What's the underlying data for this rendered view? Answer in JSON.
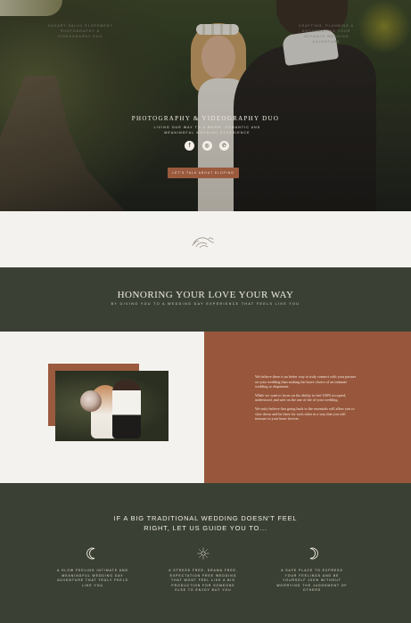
{
  "hero": {
    "title": "PHOTOGRAPHY & VIDEOGRAPHY DUO",
    "subtitle": "LIVING OUR WAY TO A WARM, ROMANTIC AND MEANINGFUL WEDDING EXPERIENCE",
    "socials": [
      {
        "icon": "facebook-icon",
        "glyph": "f"
      },
      {
        "icon": "instagram-icon",
        "glyph": "◎"
      },
      {
        "icon": "pinterest-icon",
        "glyph": "℗"
      }
    ],
    "cta_label": "LET'S TALK ABOUT ELOPING"
  },
  "strip": {
    "left_text": "SUGARY SALVO ELOPEMENT PHOTOGRAPHY & VIDEOGRAPHY DUO",
    "right_text": "CRAFTING, PLANNING & DOCUMENTING YOUR INTIMATE WEDDING ADVENTURE"
  },
  "band1": {
    "title": "HONORING YOUR LOVE YOUR WAY",
    "subtitle": "BY GIVING YOU TO A WEDDING DAY EXPERIENCE THAT FEELS LIKE YOU"
  },
  "split": {
    "paragraphs": [
      "We believe there is no better way to truly connect with your partner on your wedding than making the brave choice of an intimate wedding or elopement.",
      "While we want to focus on the ability to feel 100% accepted, understood, and safe on the one of the of your wedding.",
      "We truly believe that going back to the essentials will allow you to slow down and be there for each other in a way that you will treasure in your heart forever."
    ]
  },
  "band2": {
    "title": "IF A BIG TRADITIONAL WEDDING DOESN'T FEEL RIGHT, LET US GUIDE YOU TO...",
    "columns": [
      {
        "icon": "crescent-moon-icon",
        "text": "A SLOW FEELING INTIMATE AND MEANINGFUL WEDDING DAY ADVENTURE THAT TRULY FEELS LIKE YOU"
      },
      {
        "icon": "sun-icon",
        "text": "A STRESS FREE, DRAMA FREE, EXPECTATION FREE WEDDING THAT WONT FEEL LIKE A BIG PRODUCTION FOR SOMEONE ELSE TO ENJOY BUT YOU"
      },
      {
        "icon": "crescent-moon-right-icon",
        "text": "A SAFE PLACE TO EXPRESS YOUR FEELINGS AND BE YOURSELF 100% WITHOUT WORRYING THE JUDGEMENT OF OTHERS"
      }
    ]
  },
  "colors": {
    "green": "#3a4134",
    "terracotta": "#98573c",
    "cream": "#f4f2ee"
  }
}
